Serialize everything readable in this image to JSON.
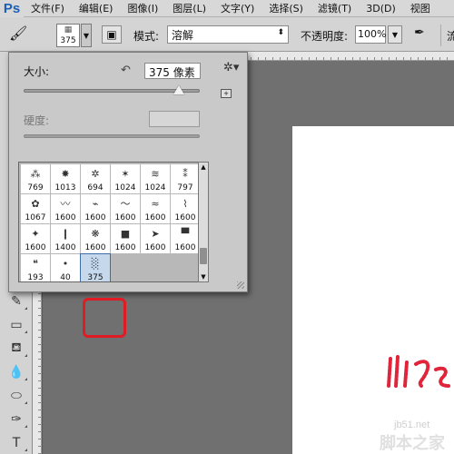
{
  "app": {
    "logo": "Ps"
  },
  "menu": [
    {
      "label": "文件(F)"
    },
    {
      "label": "编辑(E)"
    },
    {
      "label": "图像(I)"
    },
    {
      "label": "图层(L)"
    },
    {
      "label": "文字(Y)"
    },
    {
      "label": "选择(S)"
    },
    {
      "label": "滤镜(T)"
    },
    {
      "label": "3D(D)"
    },
    {
      "label": "视图"
    }
  ],
  "options": {
    "preset_value": "375",
    "mode_label": "模式:",
    "mode_value": "溶解",
    "opacity_label": "不透明度:",
    "opacity_value": "100%",
    "edge_text": "流"
  },
  "picker": {
    "size_label": "大小:",
    "size_value": "375 像素",
    "size_fraction": 0.88,
    "hardness_label": "硬度:",
    "brushes": [
      {
        "num": "769",
        "shape": "⁂"
      },
      {
        "num": "1013",
        "shape": "✸"
      },
      {
        "num": "694",
        "shape": "✲"
      },
      {
        "num": "1024",
        "shape": "✶"
      },
      {
        "num": "1024",
        "shape": "≋"
      },
      {
        "num": "797",
        "shape": "⁑"
      },
      {
        "num": "1067",
        "shape": "✿"
      },
      {
        "num": "1600",
        "shape": "〰"
      },
      {
        "num": "1600",
        "shape": "⌁"
      },
      {
        "num": "1600",
        "shape": "～"
      },
      {
        "num": "1600",
        "shape": "≈"
      },
      {
        "num": "1600",
        "shape": "⌇"
      },
      {
        "num": "1600",
        "shape": "✦"
      },
      {
        "num": "1400",
        "shape": "❙"
      },
      {
        "num": "1600",
        "shape": "❋"
      },
      {
        "num": "1600",
        "shape": "■"
      },
      {
        "num": "1600",
        "shape": "➤"
      },
      {
        "num": "1600",
        "shape": "▀"
      },
      {
        "num": "193",
        "shape": "❝"
      },
      {
        "num": "40",
        "shape": "•"
      },
      {
        "num": "375",
        "shape": "░",
        "selected": true
      }
    ]
  },
  "watermark": {
    "site": "jb51.net",
    "name": "脚本之家"
  },
  "colors": {
    "highlight": "#e01b24",
    "logo": "#1d5fb4",
    "stroke": "#e0243a"
  }
}
